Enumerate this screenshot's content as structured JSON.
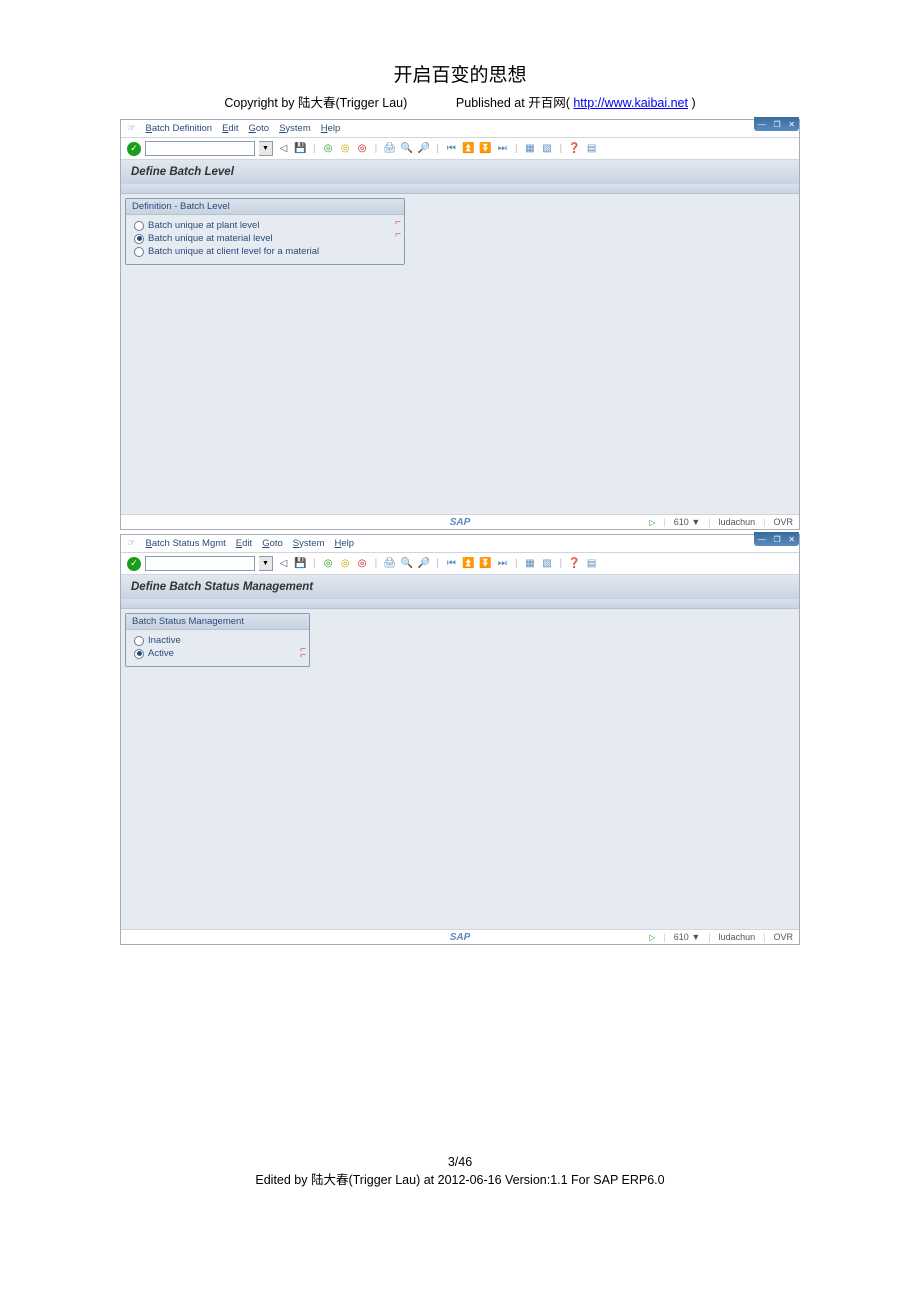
{
  "header": {
    "title": "开启百变的思想",
    "copyright_prefix": "Copyright by 陆大春(Trigger Lau)",
    "published_prefix": "Published at  开百网( ",
    "link_text": "http://www.kaibai.net",
    "link_suffix": " )"
  },
  "window1": {
    "menu": [
      "Batch Definition",
      "Edit",
      "Goto",
      "System",
      "Help"
    ],
    "screen_title": "Define Batch Level",
    "group_title": "Definition - Batch Level",
    "radios": [
      {
        "label": "Batch unique at plant level",
        "selected": false
      },
      {
        "label": "Batch unique at material level",
        "selected": true
      },
      {
        "label": "Batch unique at client level for a material",
        "selected": false
      }
    ]
  },
  "window2": {
    "menu": [
      "Batch Status Mgmt",
      "Edit",
      "Goto",
      "System",
      "Help"
    ],
    "screen_title": "Define Batch Status Management",
    "group_title": "Batch Status Management",
    "radios": [
      {
        "label": "Inactive",
        "selected": false
      },
      {
        "label": "Active",
        "selected": true
      }
    ]
  },
  "status_bar": {
    "client": "610",
    "user": "ludachun",
    "mode": "OVR"
  },
  "footer": {
    "page": "3/46",
    "line": "Edited   by   陆大春(Trigger Lau)     at 2012-06-16         Version:1.1   For SAP ERP6.0"
  }
}
